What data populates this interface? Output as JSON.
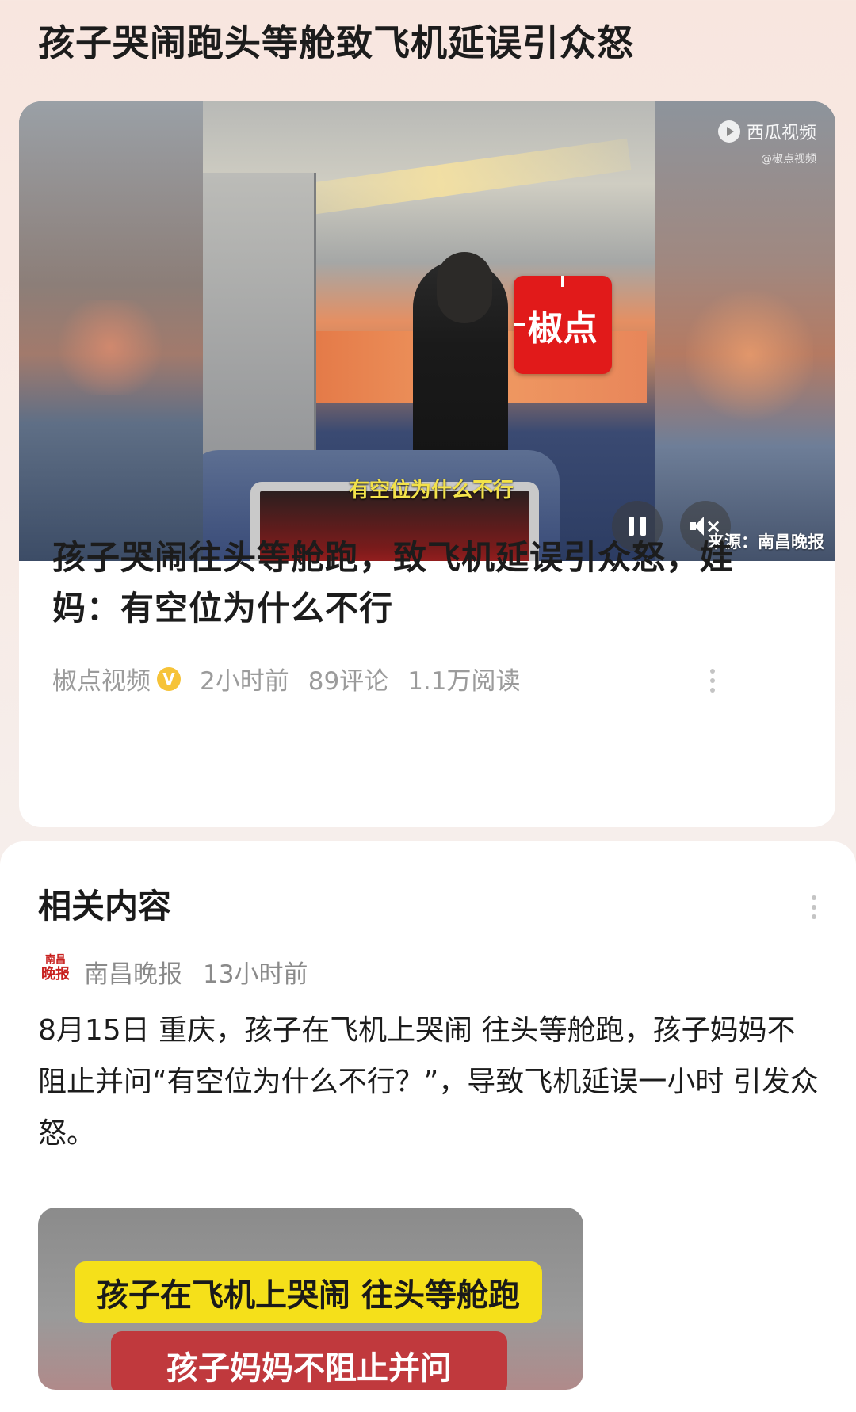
{
  "page_title": "孩子哭闹跑头等舱致飞机延误引众怒",
  "video": {
    "logo_text": "椒点",
    "subtitle": "有空位为什么不行",
    "watermark_main": "西瓜视频",
    "watermark_sub": "@椒点视频",
    "source_label": "来源：南昌晚报",
    "playback_state": "playing",
    "muted": true
  },
  "article": {
    "title": "孩子哭闹往头等舱跑，致飞机延误引众怒，娃妈：有空位为什么不行",
    "author": "椒点视频",
    "verified_badge": "V",
    "time": "2小时前",
    "comments": "89评论",
    "reads": "1.1万阅读"
  },
  "related": {
    "heading": "相关内容",
    "source_name": "南昌晚报",
    "source_logo_top": "南昌",
    "source_logo_bottom": "晚报",
    "time": "13小时前",
    "body": "8月15日 重庆，孩子在飞机上哭闹 往头等舱跑，孩子妈妈不阻止并问“有空位为什么不行？”，导致飞机延误一小时 引发众怒。",
    "thumb_caption_1": "孩子在飞机上哭闹 往头等舱跑",
    "thumb_caption_2": "孩子妈妈不阻止并问"
  },
  "colors": {
    "logo_red": "#e11a1a",
    "subtitle_yellow": "#f3e24a",
    "verify_badge": "#f6c338",
    "caption_yellow": "#f5e01a",
    "caption_red": "#c0393d"
  }
}
